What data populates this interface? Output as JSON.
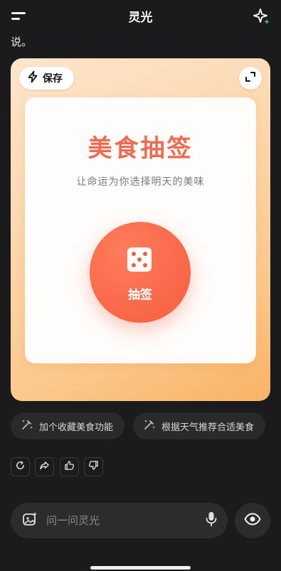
{
  "header": {
    "title": "灵光",
    "menu_icon": "menu-icon",
    "action_icon": "sparkle-icon"
  },
  "chat": {
    "previous_text": "说。"
  },
  "card": {
    "save_label": "保存",
    "title": "美食抽签",
    "subtitle": "让命运为你选择明天的美味",
    "draw_label": "抽签",
    "accent_color": "#f06a52"
  },
  "suggestions": [
    {
      "label": "加个收藏美食功能"
    },
    {
      "label": "根据天气推荐合适美食"
    }
  ],
  "actions": [
    "refresh-icon",
    "share-icon",
    "thumbs-up-icon",
    "thumbs-down-icon"
  ],
  "input": {
    "placeholder": "问一问灵光"
  }
}
